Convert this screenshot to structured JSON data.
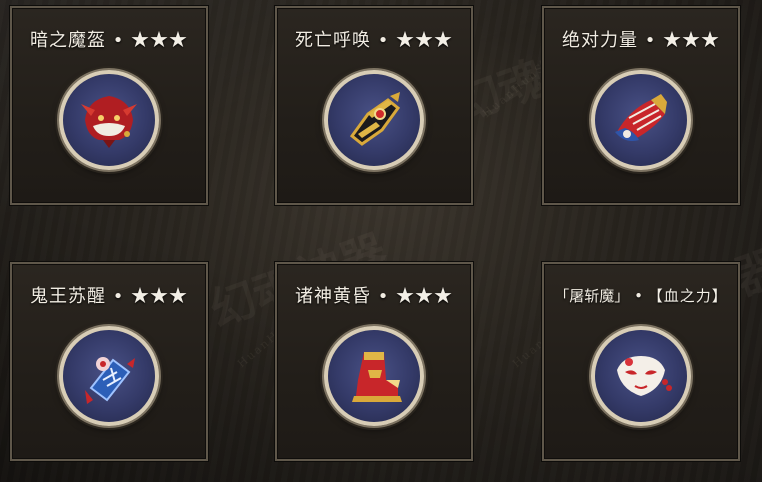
{
  "cards": [
    {
      "name": "暗之魔盔",
      "stars": "★★★",
      "sep": "•"
    },
    {
      "name": "死亡呼唤",
      "stars": "★★★",
      "sep": "•"
    },
    {
      "name": "绝对力量",
      "stars": "★★★",
      "sep": "•"
    },
    {
      "name": "鬼王苏醒",
      "stars": "★★★",
      "sep": "•"
    },
    {
      "name": "诸神黄昏",
      "stars": "★★★",
      "sep": "•"
    },
    {
      "name": "「屠斩魔」",
      "stars": "【血之力】",
      "sep": "•"
    }
  ],
  "watermark": "HuanHunShenQi",
  "background_calligraphy": "幻魂神器",
  "colors": {
    "panel_border": "#5f574a",
    "ring_outer": "#d8cdb6",
    "ring_inner": "#343a68",
    "accent_red": "#c8262a",
    "accent_gold": "#d9a93a"
  },
  "icons": [
    "demon-helmet-icon",
    "gauntlet-icon",
    "armored-arm-icon",
    "lantern-icon",
    "boot-icon",
    "fox-mask-icon"
  ]
}
